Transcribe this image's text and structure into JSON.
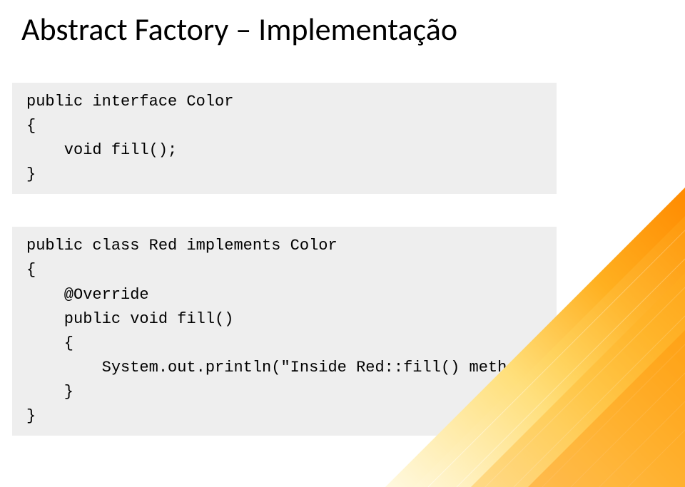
{
  "title": "Abstract Factory – Implementação",
  "code_block_1": "public interface Color \n{\n    void fill();\n}",
  "code_block_2": "public class Red implements Color \n{\n    @Override\n    public void fill() \n    {\n        System.out.println(\"Inside Red::fill() method.\");\n    }\n}"
}
